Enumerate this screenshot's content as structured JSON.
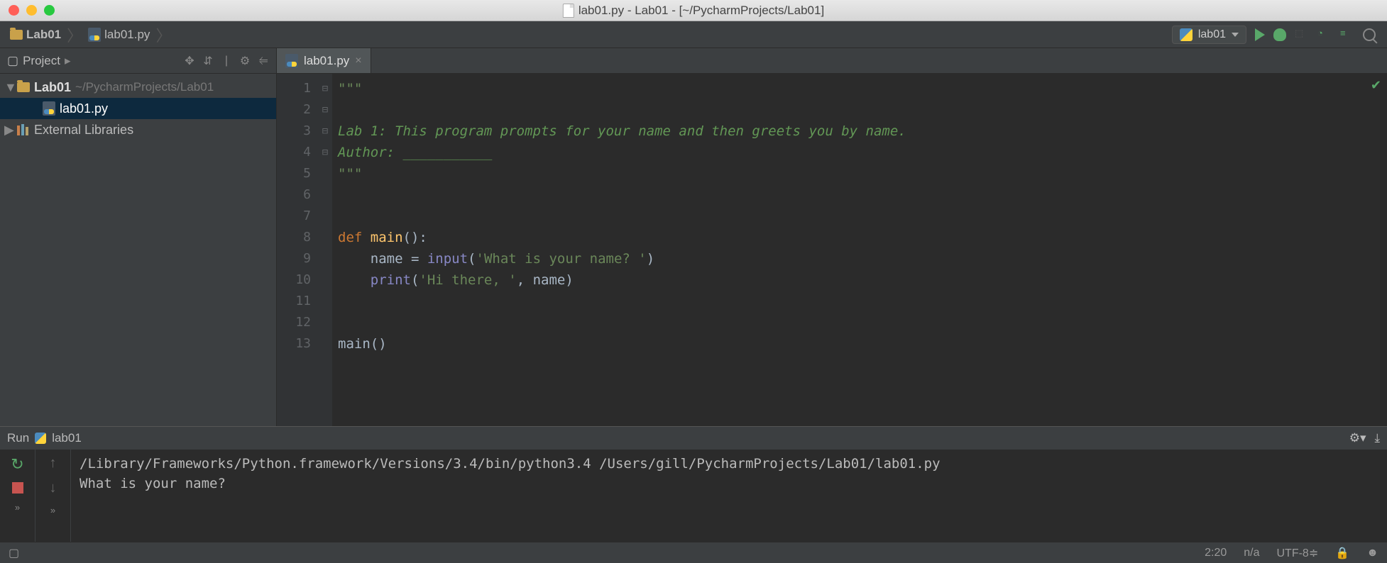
{
  "window": {
    "title": "lab01.py - Lab01 - [~/PycharmProjects/Lab01]"
  },
  "breadcrumb": {
    "project": "Lab01",
    "file": "lab01.py"
  },
  "toolbar": {
    "run_config": "lab01"
  },
  "project_panel": {
    "title": "Project",
    "root_name": "Lab01",
    "root_path": "~/PycharmProjects/Lab01",
    "file": "lab01.py",
    "external": "External Libraries"
  },
  "editor": {
    "tab": "lab01.py",
    "lines": [
      "1",
      "2",
      "3",
      "4",
      "5",
      "6",
      "7",
      "8",
      "9",
      "10",
      "11",
      "12",
      "13"
    ],
    "code": {
      "l1": "\"\"\"",
      "l3": "Lab 1: This program prompts for your name and then greets you by name.",
      "l4": "Author: ___________",
      "l5": "\"\"\"",
      "l8_def": "def ",
      "l8_fn": "main",
      "l8_rest": "():",
      "l9a": "    name = ",
      "l9b": "input",
      "l9c": "(",
      "l9d": "'What is your name? '",
      "l9e": ")",
      "l10a": "    ",
      "l10b": "print",
      "l10c": "(",
      "l10d": "'Hi there, '",
      "l10e": ", name)",
      "l13": "main()"
    }
  },
  "run": {
    "title": "Run",
    "config": "lab01",
    "line1": "/Library/Frameworks/Python.framework/Versions/3.4/bin/python3.4 /Users/gill/PycharmProjects/Lab01/lab01.py",
    "line2": "What is your name? "
  },
  "status": {
    "pos": "2:20",
    "na": "n/a",
    "encoding": "UTF-8",
    "lock": "🔒"
  }
}
